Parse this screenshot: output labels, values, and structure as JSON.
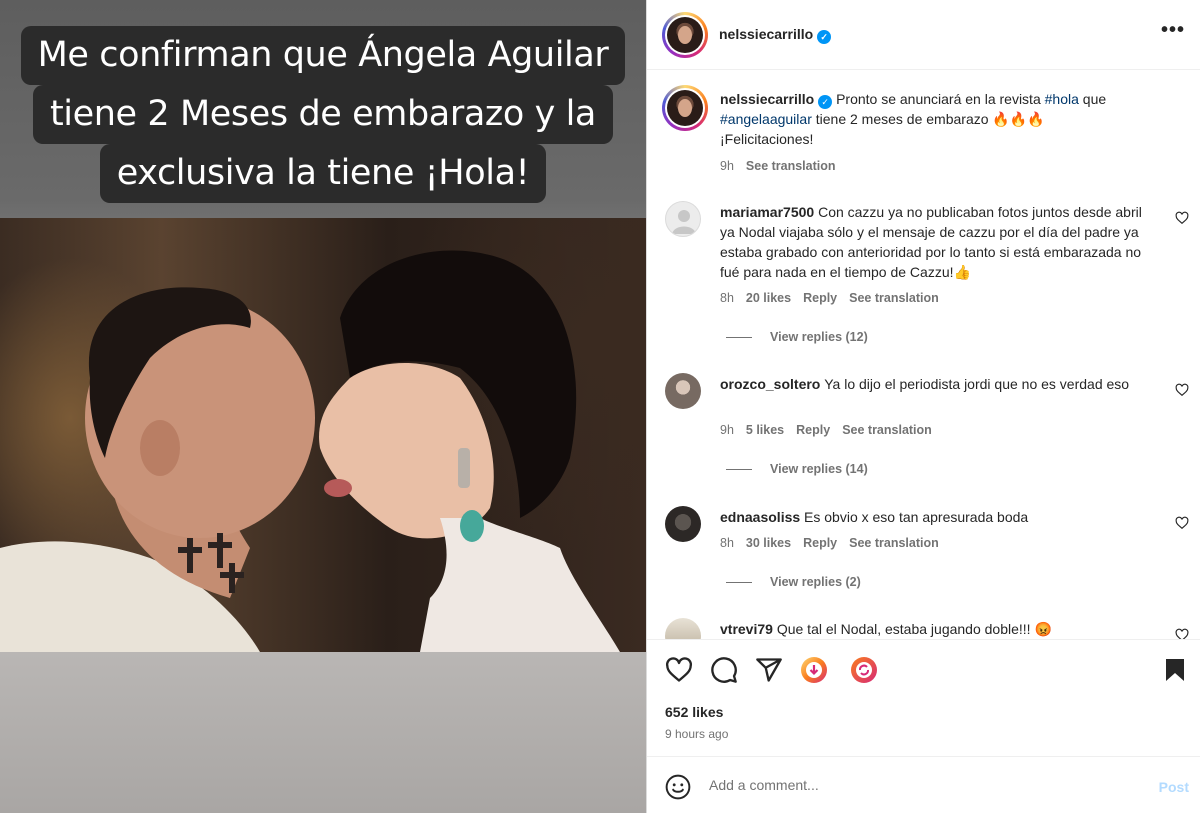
{
  "media": {
    "caption_lines": [
      "Me confirman que Ángela Aguilar",
      "tiene 2 Meses de embarazo y la",
      "exclusiva la tiene ¡Hola!"
    ]
  },
  "header": {
    "username": "nelssiecarrillo",
    "verified": true,
    "more": "•••"
  },
  "post_caption": {
    "username": "nelssiecarrillo",
    "text_1": "Pronto se anunciará en la revista ",
    "tag_1": "#hola",
    "text_2": " que ",
    "tag_2": "#angelaaguilar",
    "text_3": " tiene 2 meses de embarazo 🔥🔥🔥",
    "text_4": "¡Felicitaciones!",
    "time": "9h",
    "see_translation": "See translation"
  },
  "comments": [
    {
      "username": "mariamar7500",
      "text": "Con cazzu ya no publicaban fotos juntos desde abril ya Nodal viajaba sólo y el mensaje de cazzu por el día del padre ya estaba grabado con anterioridad por lo tanto si está embarazada no fué para nada en el tiempo de Cazzu!👍",
      "time": "8h",
      "likes": "20 likes",
      "reply": "Reply",
      "see_translation": "See translation",
      "view_replies": "View replies (12)"
    },
    {
      "username": "orozco_soltero",
      "text": "Ya lo dijo el periodista jordi que no es verdad eso",
      "time": "9h",
      "likes": "5 likes",
      "reply": "Reply",
      "see_translation": "See translation",
      "view_replies": "View replies (14)"
    },
    {
      "username": "ednaasoliss",
      "text": "Es obvio x eso tan apresurada boda",
      "time": "8h",
      "likes": "30 likes",
      "reply": "Reply",
      "see_translation": "See translation",
      "view_replies": "View replies (2)"
    },
    {
      "username": "vtrevi79",
      "text": "Que tal el Nodal, estaba jugando doble!!! 😡"
    }
  ],
  "footer": {
    "likes": "652 likes",
    "time": "9 hours ago",
    "add_comment_placeholder": "Add a comment...",
    "post_label": "Post"
  },
  "colors": {
    "link": "#00376b",
    "verified": "#0095f6",
    "post_disabled": "#b3dbff"
  }
}
